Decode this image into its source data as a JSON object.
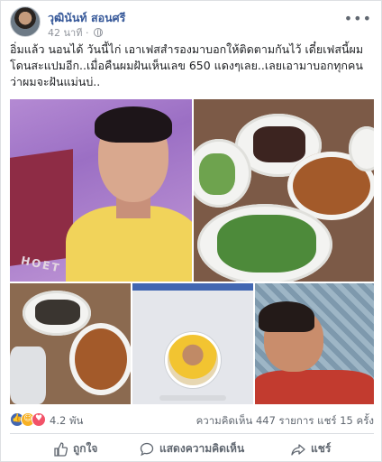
{
  "post": {
    "author": "วุฒินันท์ สอนศรี",
    "time": "42 นาที",
    "text": "อิ่มแล้ว นอนได้ วันนี้ไก่ เอาเฟสสำรองมาบอกให้ติดตามกันไว้ เดี๋ยเฟสนี้ผม\nโดนสะแปมอีก..เมื่อคืนผมฝันเห็นเลข 650 แดงๆเลย..เลยเอามาบอกทุกคน\nว่าผมจะฝันแม่นบ่.."
  },
  "photos": [
    {
      "id": "selfie-car",
      "label": "HOET"
    },
    {
      "id": "food-spread"
    },
    {
      "id": "food-bowl"
    },
    {
      "id": "profile-card"
    },
    {
      "id": "selfie-tile"
    }
  ],
  "stats": {
    "reaction_count": "4.2 พัน",
    "comments_label": "ความคิดเห็น 447 รายการ",
    "shares_label": "แชร์ 15 ครั้ง",
    "reaction_icons": [
      "like-icon",
      "haha-icon",
      "love-icon"
    ]
  },
  "actions": {
    "like_label": "ถูกใจ",
    "comment_label": "แสดงความคิดเห็น",
    "share_label": "แชร์"
  },
  "colors": {
    "author": "#365899",
    "like": "#4267b2",
    "muted": "#606770"
  }
}
